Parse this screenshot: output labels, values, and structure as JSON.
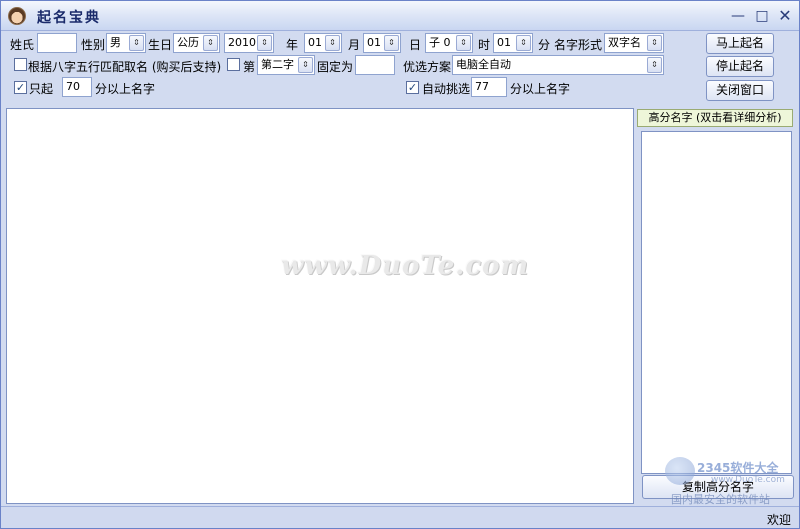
{
  "window": {
    "title": "起名宝典",
    "controls": {
      "minimize": "—",
      "maximize": "□",
      "close": "✕"
    }
  },
  "row1": {
    "surname_label": "姓氏",
    "surname_value": "",
    "gender_label": "性别",
    "gender_value": "男",
    "birth_label": "生日",
    "calendar_value": "公历",
    "year_value": "2010",
    "year_label": "年",
    "month_value": "01",
    "month_label": "月",
    "day_value": "01",
    "day_label": "日",
    "hour_branch_value": "子 0",
    "hour_label": "时",
    "minute_value": "01",
    "minute_label": "分",
    "name_form_label": "名字形式",
    "name_form_value": "双字名"
  },
  "row2": {
    "bazi_checkbox_label": "根据八字五行匹配取名 (购买后支持)",
    "bazi_checked": false,
    "fixed_checkbox_label": "第",
    "fixed_checked": false,
    "char_position_value": "第二字",
    "fixed_as_label": "固定为",
    "fixed_char_value": "",
    "scheme_label": "优选方案",
    "scheme_value": "电脑全自动"
  },
  "row3": {
    "only_checkbox_label": "只起",
    "only_checked": true,
    "min_score_value": "70",
    "min_score_suffix": "分以上名字",
    "auto_pick_label": "自动挑选",
    "auto_pick_checked": true,
    "auto_score_value": "77",
    "auto_score_suffix": "分以上名字"
  },
  "buttons": {
    "start": "马上起名",
    "stop": "停止起名",
    "close": "关闭窗口"
  },
  "main": {
    "watermark": "www.DuoTe.com"
  },
  "high_score": {
    "header": "高分名字 (双击看详细分析)",
    "copy_button": "复制高分名字"
  },
  "status": {
    "text": "欢迎"
  },
  "overlay_logo": {
    "line1": "2345软件大全",
    "line2": "www.DuoTe.com",
    "line3": "国内最安全的软件站"
  }
}
